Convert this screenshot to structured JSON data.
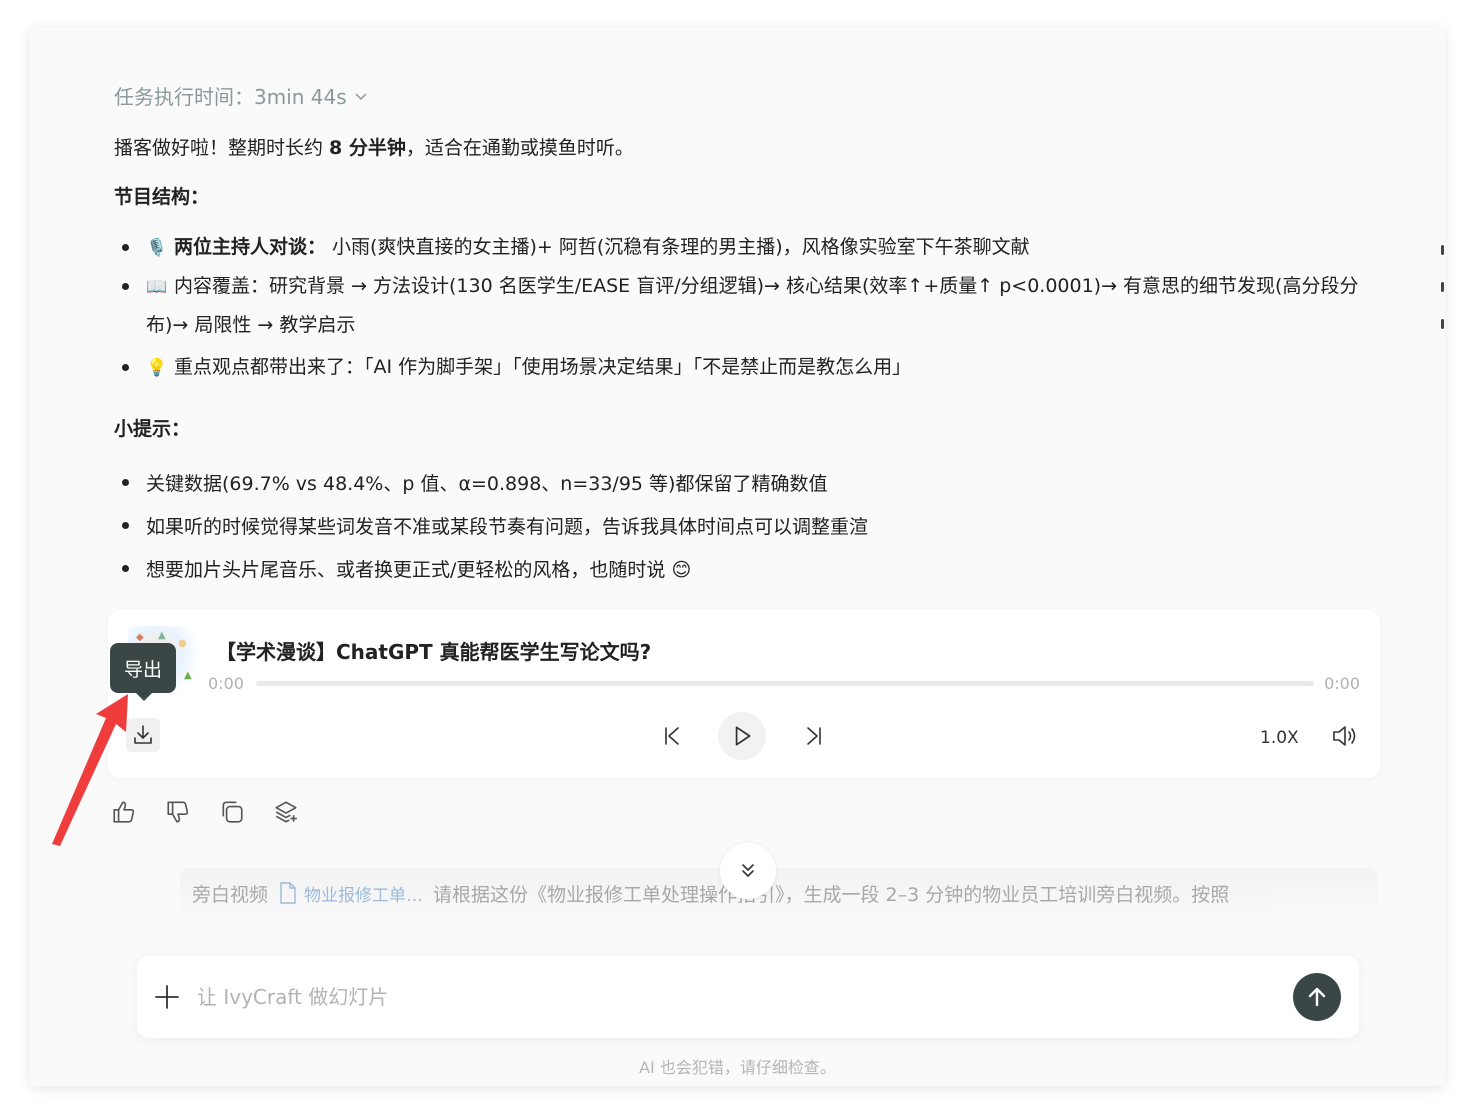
{
  "exec_time": {
    "label": "任务执行时间：3min 44s"
  },
  "intro": {
    "prefix": "播客做好啦！整期时长约 ",
    "bold": "8 分半钟",
    "suffix": "，适合在通勤或摸鱼时听。"
  },
  "structure": {
    "heading": "节目结构：",
    "items": [
      {
        "emoji": "🎙️",
        "bold": "两位主持人对谈：",
        "text": " 小雨(爽快直接的女主播)+ 阿哲(沉稳有条理的男主播)，风格像实验室下午茶聊文献"
      },
      {
        "emoji": "📖",
        "bold": "",
        "text": "内容覆盖：研究背景 → 方法设计(130 名医学生/EASE 盲评/分组逻辑)→ 核心结果(效率↑+质量↑ p<0.0001)→ 有意思的细节发现(高分段分布)→ 局限性 → 教学启示"
      },
      {
        "emoji": "💡",
        "bold": "",
        "text": "重点观点都带出来了：「AI 作为脚手架」「使用场景决定结果」「不是禁止而是教怎么用」"
      }
    ]
  },
  "tips": {
    "heading": "小提示：",
    "items": [
      "关键数据(69.7% vs 48.4%、p 值、α=0.898、n=33/95 等)都保留了精确数值",
      "如果听的时候觉得某些词发音不准或某段节奏有问题，告诉我具体时间点可以调整重渲",
      "想要加片头片尾音乐、或者换更正式/更轻松的风格，也随时说 😊"
    ]
  },
  "player": {
    "title": "【学术漫谈】ChatGPT 真能帮医学生写论文吗?",
    "time_current": "0:00",
    "time_total": "0:00",
    "progress": 0,
    "speed": "1.0X",
    "tooltip": "导出"
  },
  "previous_message": {
    "tag": "旁白视频",
    "file": "物业报修工单…",
    "text": "请根据这份《物业报修工单处理操作指引》，生成一段 2–3 分钟的物业员工培训旁白视频。按照"
  },
  "composer": {
    "placeholder": "让 IvyCraft 做幻灯片"
  },
  "disclaimer": "AI 也会犯错，请仔细检查。",
  "colors": {
    "accent": "#3b4747",
    "muted": "#8a9a9a"
  },
  "icons": [
    "chevron-down-icon",
    "download-icon",
    "skip-back-icon",
    "play-icon",
    "skip-forward-icon",
    "volume-icon",
    "thumbs-up-icon",
    "thumbs-down-icon",
    "copy-icon",
    "layers-icon",
    "double-chevron-down-icon",
    "document-icon",
    "plus-icon",
    "arrow-up-icon"
  ]
}
